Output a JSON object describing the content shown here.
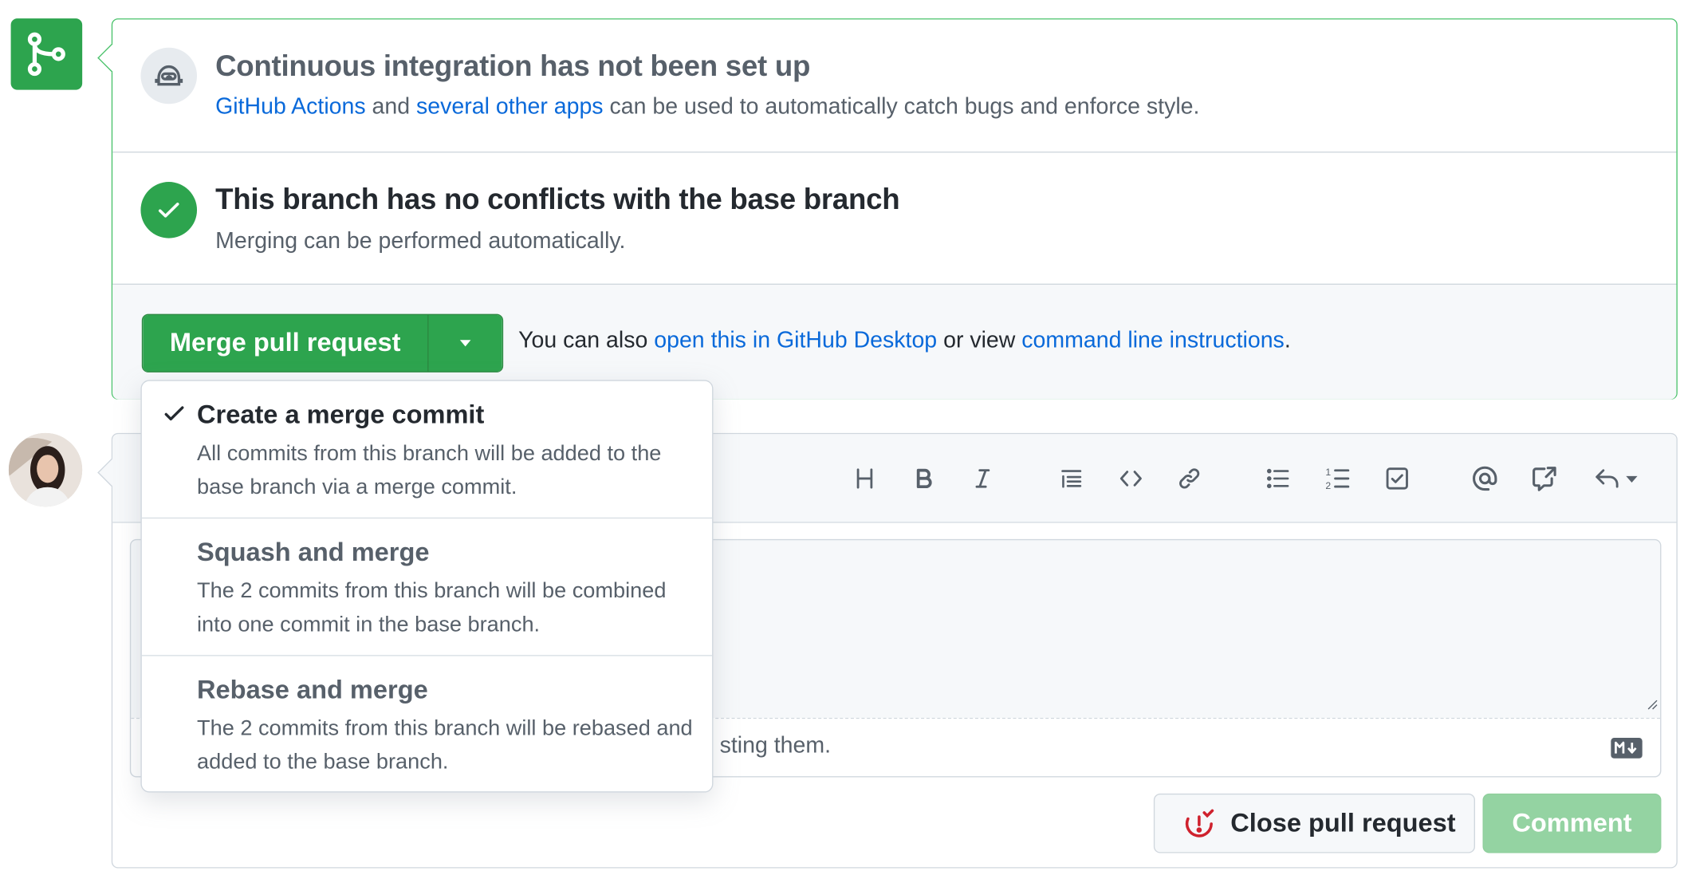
{
  "ci": {
    "title": "Continuous integration has not been set up",
    "link1": "GitHub Actions",
    "text1": " and ",
    "link2": "several other apps",
    "text2": " can be used to automatically catch bugs and enforce style."
  },
  "conflicts": {
    "title": "This branch has no conflicts with the base branch",
    "text": "Merging can be performed automatically."
  },
  "merge": {
    "button_label": "Merge pull request",
    "also_prefix": "You can also ",
    "desktop_link": "open this in GitHub Desktop",
    "or_view": " or view ",
    "cli_link": "command line instructions",
    "period": "."
  },
  "dropdown": {
    "items": [
      {
        "title": "Create a merge commit",
        "desc": "All commits from this branch will be added to the base branch via a merge commit.",
        "selected": true
      },
      {
        "title": "Squash and merge",
        "desc": "The 2 commits from this branch will be combined into one commit in the base branch.",
        "selected": false
      },
      {
        "title": "Rebase and merge",
        "desc": "The 2 commits from this branch will be rebased and added to the base branch.",
        "selected": false
      }
    ]
  },
  "comment": {
    "attach_text": "sting them.",
    "close_label": "Close pull request",
    "comment_label": "Comment"
  },
  "toolbar_icons": [
    "heading-icon",
    "bold-icon",
    "italic-icon",
    "quote-icon",
    "code-icon",
    "link-icon",
    "unordered-list-icon",
    "ordered-list-icon",
    "task-list-icon",
    "mention-icon",
    "cross-reference-icon",
    "reply-icon"
  ],
  "colors": {
    "accent_green": "#2da44e",
    "link_blue": "#0969da",
    "disabled_green": "#94d3a2",
    "danger_red": "#cf222e"
  }
}
